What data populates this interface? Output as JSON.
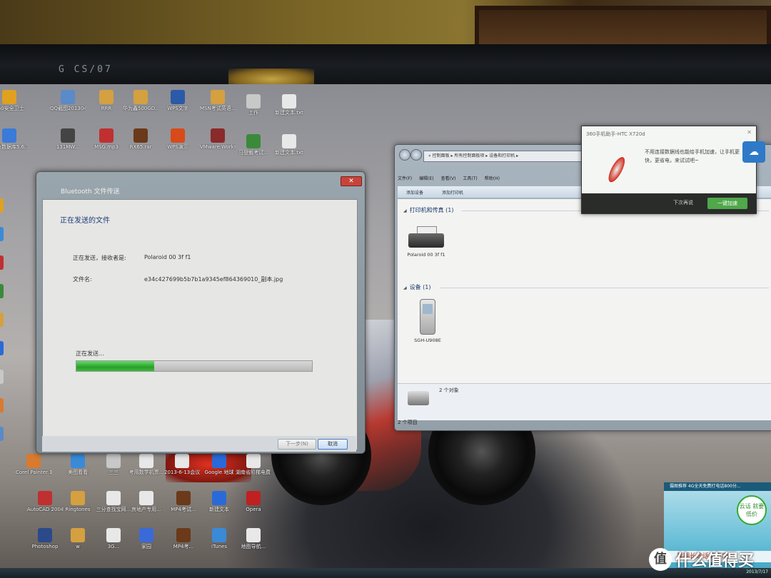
{
  "monitor": {
    "label": "G CS/07"
  },
  "bluetooth_dialog": {
    "title": "Bluetooth 文件传送",
    "heading": "正在发送的文件",
    "sending_to_label": "正在发送，接收者是:",
    "sending_to_value": "Polaroid 00 3f f1",
    "filename_label": "文件名:",
    "filename_value": "e34c427699b5b7b1a9345ef864369010_副本.jpg",
    "status": "正在发送...",
    "progress": 0.33,
    "next_button": "下一步(N)",
    "cancel_button": "取消"
  },
  "devices_window": {
    "address": "« 控制面板 ▸ 所有控制面板项 ▸ 设备和打印机 ▸",
    "menu": [
      "文件(F)",
      "编辑(E)",
      "查看(V)",
      "工具(T)",
      "帮助(H)"
    ],
    "toolbar": [
      "添加设备",
      "添加打印机"
    ],
    "group_printers": "打印机和传真 (1)",
    "printer_name": "Polaroid 00 3f f1",
    "group_devices": "设备 (1)",
    "device_name": "SGH-U908E",
    "details_count": "2 个对象",
    "status_bar": "2 个项目"
  },
  "popup_360": {
    "title": "360手机助手-HTC X720d",
    "message": "不用连接数据线也能给手机加速，让手机更快，更省电，来试试吧~",
    "later": "下次再说",
    "go": "一键加速"
  },
  "ad_widget": {
    "top": "摄图推荐 4G全天免费打电话800分...",
    "badge": "云话 就要低价",
    "bottom": "暑期长途话费不用愁"
  },
  "taskbar": {
    "time": "2013/7/17"
  },
  "watermark": "值 什么值得买",
  "desktop_icons": [
    {
      "label": "360安全卫士",
      "color": "#e0a020"
    },
    {
      "label": "QQ截图20130423...",
      "color": "#5a8ac8"
    },
    {
      "label": "RRR",
      "color": "#d4a040"
    },
    {
      "label": "华为鑫500GD...",
      "color": "#d4a040"
    },
    {
      "label": "WPS文字",
      "color": "#2a5aa8"
    },
    {
      "label": "MSN考试英语...",
      "color": "#d4a040"
    },
    {
      "label": "工作",
      "color": "#c8c8c8"
    },
    {
      "label": "新建文本.txt",
      "color": "#e8e8e8"
    },
    {
      "label": "大鱼数据库5.6.1",
      "color": "#3a7ad8"
    },
    {
      "label": "131MW...",
      "color": "#444"
    },
    {
      "label": "MSG.mp3",
      "color": "#c03030"
    },
    {
      "label": "RX65.rar",
      "color": "#6a3a1a"
    },
    {
      "label": "WPS演示",
      "color": "#d84a1a"
    },
    {
      "label": "VMware Workstation",
      "color": "#8a2a2a"
    },
    {
      "label": "马登魁考试...",
      "color": "#3a8a3a"
    },
    {
      "label": "新建文本.txt",
      "color": "#e8e8e8"
    },
    {
      "label": "Corel Painter 11...",
      "color": "#d87a30"
    },
    {
      "label": "美图看看",
      "color": "#3a8ad8"
    },
    {
      "label": "三三",
      "color": "#c8c8c8"
    },
    {
      "label": "考用数学机票...",
      "color": "#e8e8e8"
    },
    {
      "label": "2013-6-13会议通知...",
      "color": "#e8e8e8"
    },
    {
      "label": "Google 地球",
      "color": "#2a6ad8"
    },
    {
      "label": "湖南省阶梯电费7月JCEI...",
      "color": "#e8e8e8"
    },
    {
      "label": "AutoCAD 2004 Chs",
      "color": "#c03030"
    },
    {
      "label": "Ringtones",
      "color": "#d4a040"
    },
    {
      "label": "三分查找宝网...",
      "color": "#e8e8e8"
    },
    {
      "label": "房地产专用...",
      "color": "#e8e8e8"
    },
    {
      "label": "MP4考试...",
      "color": "#6a3a1a"
    },
    {
      "label": "新建文本",
      "color": "#2a6ad8"
    },
    {
      "label": "Opera",
      "color": "#c02020"
    },
    {
      "label": "Photoshop",
      "color": "#2a4a8a"
    },
    {
      "label": "w",
      "color": "#d4a040"
    },
    {
      "label": "3G...",
      "color": "#e8e8e8"
    },
    {
      "label": "家园",
      "color": "#3a6ad8"
    },
    {
      "label": "MP4考...",
      "color": "#6a3a1a"
    },
    {
      "label": "iTunes",
      "color": "#3a8ad8"
    },
    {
      "label": "地图导航...",
      "color": "#e8e8e8"
    }
  ]
}
